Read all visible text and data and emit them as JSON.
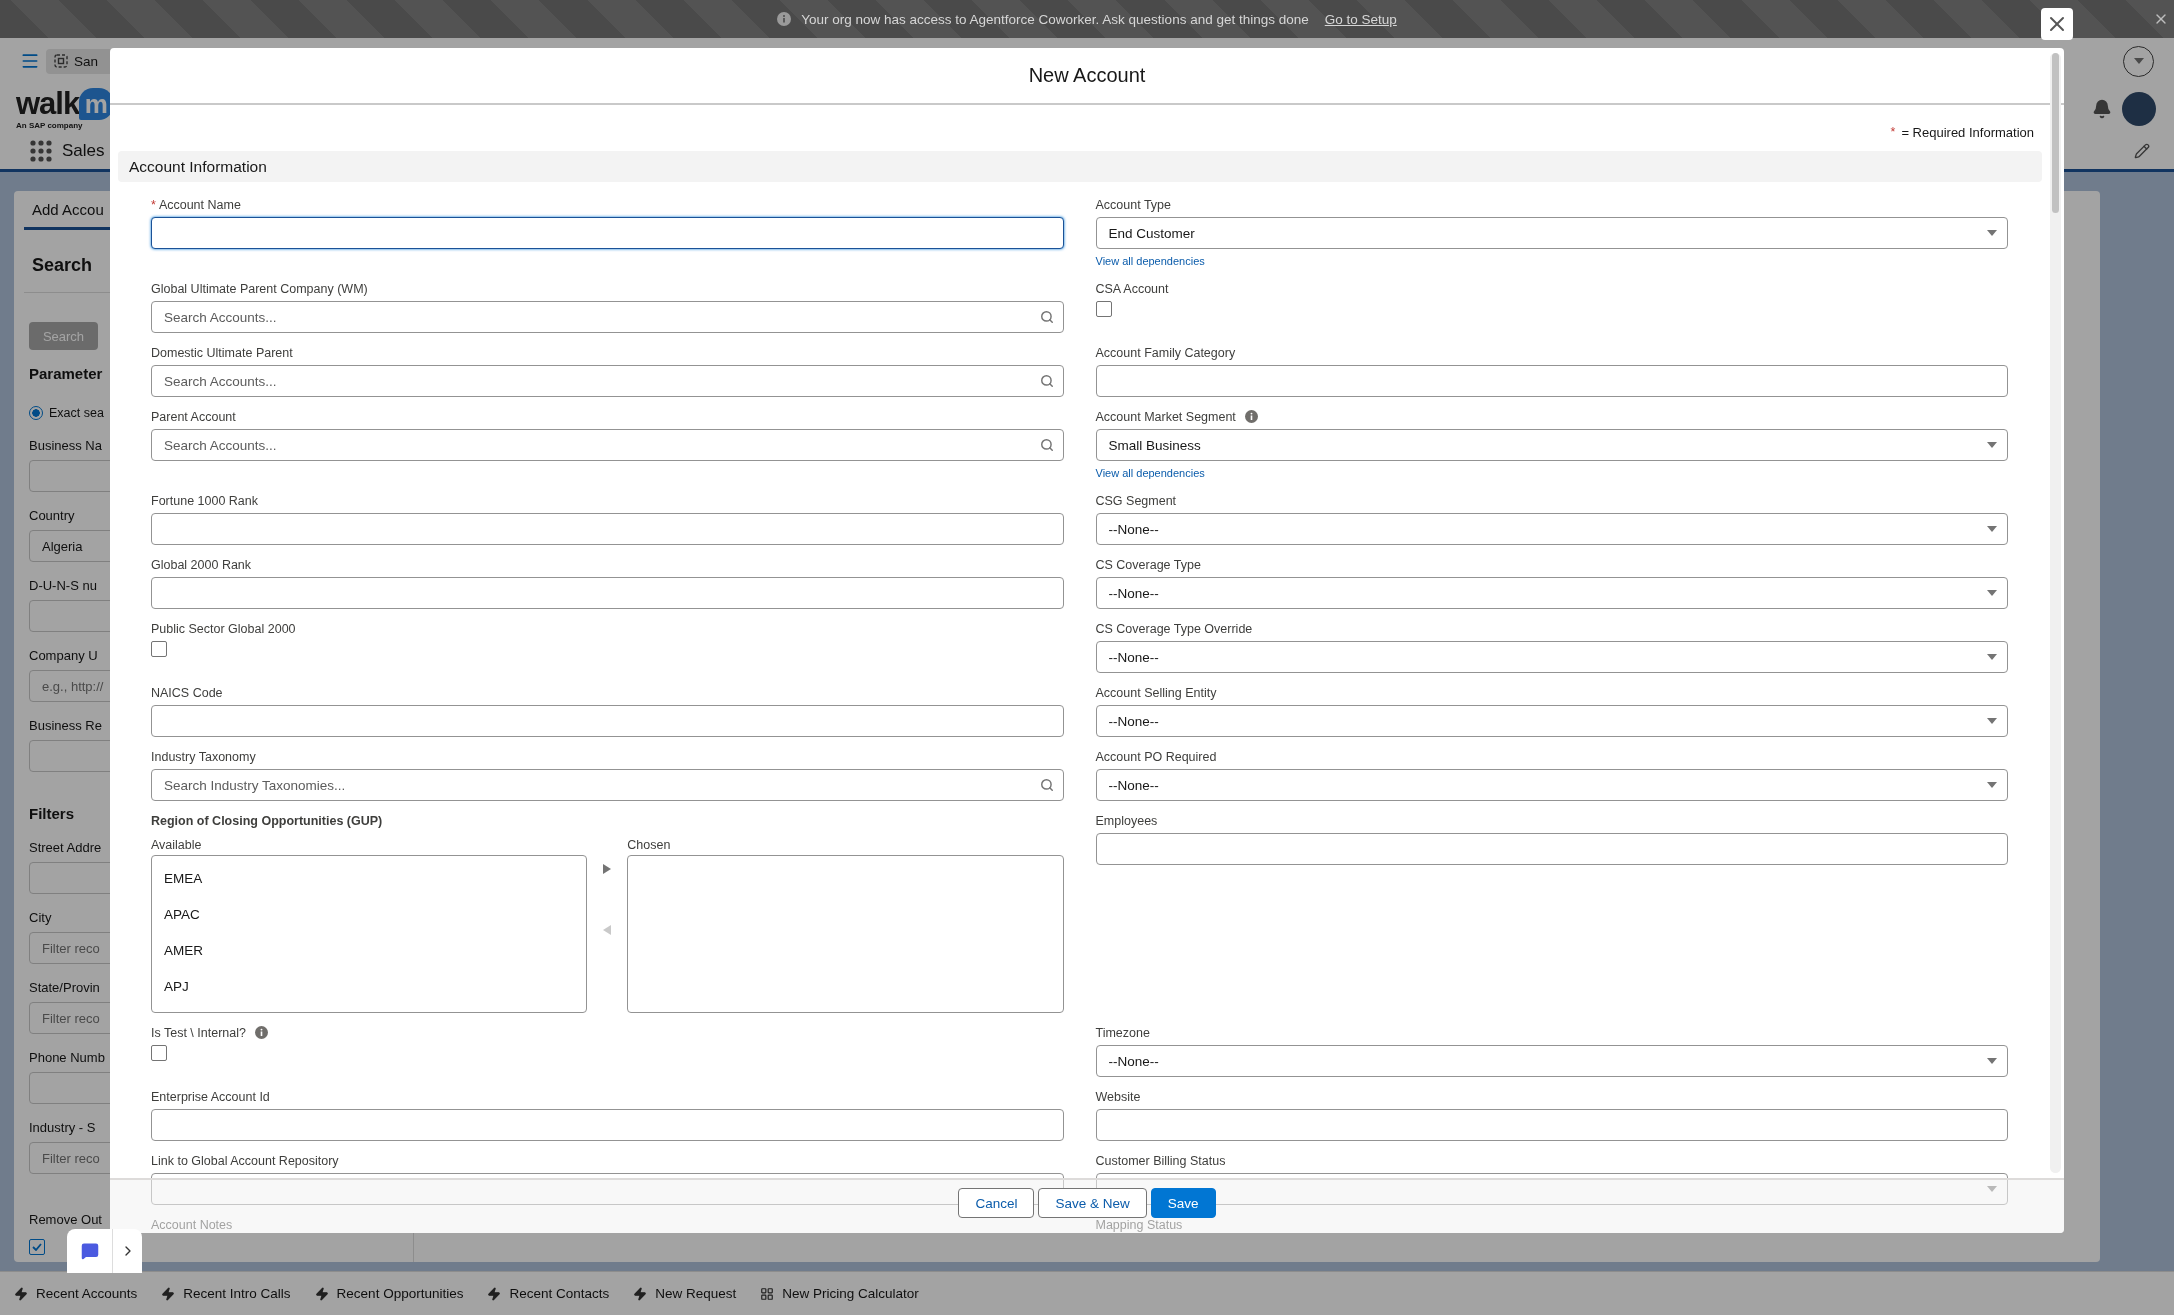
{
  "banner": {
    "message": "Your org now has access to Agentforce Coworker. Ask questions and get things done",
    "link": "Go to Setup"
  },
  "app_header": {
    "tab": "San",
    "logo": {
      "text": "walk",
      "badge": "m",
      "tagline": "An SAP company"
    },
    "app_name": "Sales"
  },
  "search_panel": {
    "tab": "Add Accou",
    "title": "Search",
    "search_button": "Search",
    "parameters_heading": "Parameter",
    "search_mode": {
      "label": "Exact sea",
      "selected": true
    },
    "parameters": [
      {
        "kind": "text",
        "label": "Business Na"
      },
      {
        "kind": "select",
        "label": "Country",
        "value": "Algeria"
      },
      {
        "kind": "text",
        "label": "D-U-N-S nu"
      },
      {
        "kind": "text",
        "label": "Company U",
        "placeholder": "e.g., http://"
      },
      {
        "kind": "text",
        "label": "Business Re"
      }
    ],
    "filters_heading": "Filters",
    "filters": [
      {
        "kind": "text",
        "label": "Street Addre"
      },
      {
        "kind": "text",
        "label": "City",
        "placeholder": "Filter reco"
      },
      {
        "kind": "text",
        "label": "State/Provin",
        "placeholder": "Filter reco"
      },
      {
        "kind": "text",
        "label": "Phone Numb"
      },
      {
        "kind": "text",
        "label": "Industry - S",
        "placeholder": "Filter reco"
      }
    ],
    "remove_option": {
      "label": "Remove Out",
      "checked": true
    }
  },
  "modal": {
    "title": "New Account",
    "required_mark": "*",
    "required_note": "= Required Information",
    "section": "Account Information",
    "rows": [
      {
        "left": {
          "kind": "text",
          "label": "Account Name",
          "required": true,
          "focused": true
        },
        "right": {
          "kind": "select",
          "label": "Account Type",
          "value": "End Customer",
          "link": "View all dependencies",
          "required": false,
          "focused": false
        }
      },
      {
        "left": {
          "kind": "lookup",
          "label": "Global Ultimate Parent Company (WM)",
          "placeholder": "Search Accounts...",
          "required": false,
          "focused": false
        },
        "right": {
          "kind": "checkbox",
          "label": "CSA Account",
          "required": false,
          "checked": false
        }
      },
      {
        "left": {
          "kind": "lookup",
          "label": "Domestic Ultimate Parent",
          "placeholder": "Search Accounts...",
          "required": false,
          "focused": false
        },
        "right": {
          "kind": "text",
          "label": "Account Family Category",
          "required": false,
          "focused": false
        }
      },
      {
        "left": {
          "kind": "lookup",
          "label": "Parent Account",
          "placeholder": "Search Accounts...",
          "required": false,
          "focused": false
        },
        "right": {
          "kind": "select",
          "label": "Account Market Segment",
          "info": true,
          "value": "Small Business",
          "link": "View all dependencies",
          "required": false,
          "focused": false
        }
      },
      {
        "left": {
          "kind": "text",
          "label": "Fortune 1000 Rank",
          "required": false,
          "focused": false
        },
        "right": {
          "kind": "select",
          "label": "CSG Segment",
          "value": "--None--",
          "required": false,
          "focused": false
        }
      },
      {
        "left": {
          "kind": "text",
          "label": "Global 2000 Rank",
          "required": false,
          "focused": false
        },
        "right": {
          "kind": "select",
          "label": "CS Coverage Type",
          "value": "--None--",
          "required": false,
          "focused": false
        }
      },
      {
        "left": {
          "kind": "checkbox",
          "label": "Public Sector Global 2000",
          "required": false,
          "checked": false
        },
        "right": {
          "kind": "select",
          "label": "CS Coverage Type Override",
          "value": "--None--",
          "required": false,
          "focused": false
        }
      },
      {
        "left": {
          "kind": "text",
          "label": "NAICS Code",
          "required": false,
          "focused": false
        },
        "right": {
          "kind": "select",
          "label": "Account Selling Entity",
          "value": "--None--",
          "required": false,
          "focused": false
        }
      },
      {
        "left": {
          "kind": "lookup",
          "label": "Industry Taxonomy",
          "placeholder": "Search Industry Taxonomies...",
          "required": false,
          "focused": false
        },
        "right": {
          "kind": "select",
          "label": "Account PO Required",
          "value": "--None--",
          "required": false,
          "focused": false
        }
      },
      {
        "left": {
          "kind": "duallist",
          "label": "Region of Closing Opportunities (GUP)",
          "required": false,
          "available_label": "Available",
          "chosen_label": "Chosen",
          "available": [
            {
              "label": "EMEA",
              "selected": false
            },
            {
              "label": "APAC",
              "selected": false
            },
            {
              "label": "AMER",
              "selected": false
            },
            {
              "label": "APJ",
              "selected": false
            }
          ],
          "move_buttons": [
            {
              "kind": "right",
              "disabled": false
            },
            {
              "kind": "left",
              "disabled": true
            }
          ]
        },
        "right": {
          "kind": "text",
          "label": "Employees",
          "required": false,
          "focused": false
        }
      },
      {
        "left": {
          "kind": "checkbox",
          "label": "Is Test \\ Internal?",
          "info": true,
          "required": false,
          "checked": false
        },
        "right": {
          "kind": "select",
          "label": "Timezone",
          "value": "--None--",
          "required": false,
          "focused": false
        }
      },
      {
        "left": {
          "kind": "text",
          "label": "Enterprise Account Id",
          "required": false,
          "focused": false
        },
        "right": {
          "kind": "text",
          "label": "Website",
          "required": false,
          "focused": false
        }
      },
      {
        "left": {
          "kind": "text",
          "label": "Link to Global Account Repository",
          "required": false,
          "focused": false
        },
        "right": {
          "kind": "select",
          "label": "Customer Billing Status",
          "required": false,
          "focused": false
        }
      },
      {
        "left": {
          "kind": "label",
          "label": "Account Notes",
          "required": false
        },
        "right": {
          "kind": "label",
          "label": "Mapping Status",
          "required": false
        }
      }
    ],
    "footer_buttons": [
      {
        "label": "Cancel",
        "kind": "neutral"
      },
      {
        "label": "Save & New",
        "kind": "neutral"
      },
      {
        "label": "Save",
        "kind": "brand"
      }
    ]
  },
  "utility_bar": [
    {
      "label": "Recent Accounts",
      "kind": "bolt"
    },
    {
      "label": "Recent Intro Calls",
      "kind": "bolt"
    },
    {
      "label": "Recent Opportunities",
      "kind": "bolt"
    },
    {
      "label": "Recent Contacts",
      "kind": "bolt"
    },
    {
      "label": "New Request",
      "kind": "bolt"
    },
    {
      "label": "New Pricing Calculator",
      "kind": "calculator"
    }
  ]
}
